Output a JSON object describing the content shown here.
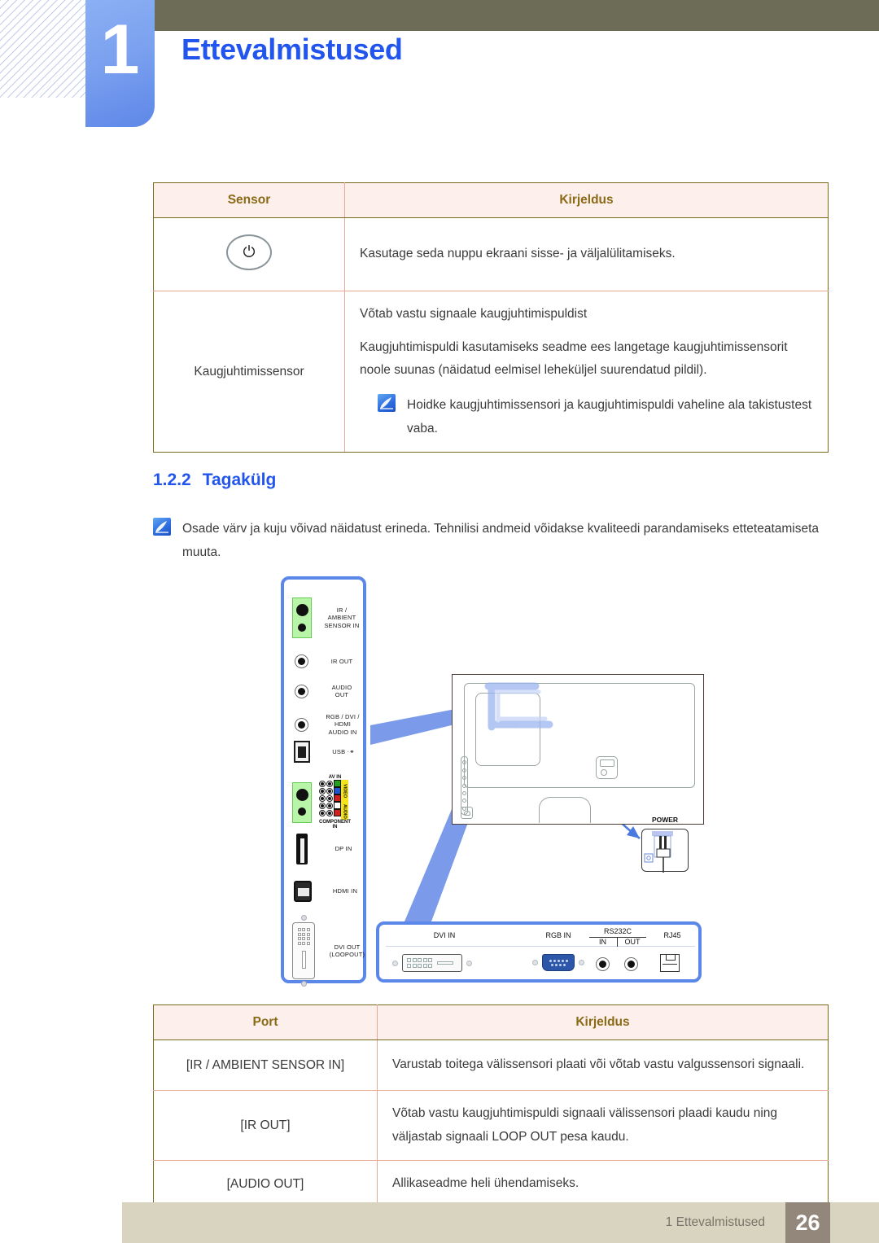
{
  "header": {
    "chapter_number": "1",
    "chapter_title": "Ettevalmistused"
  },
  "sensor_table": {
    "columns": [
      "Sensor",
      "Kirjeldus"
    ],
    "rows": [
      {
        "label": "",
        "label_icon": "power-icon",
        "paragraphs": [
          "Kasutage seda nuppu ekraani sisse- ja väljalülitamiseks."
        ],
        "note": null
      },
      {
        "label": "Kaugjuhtimissensor",
        "label_icon": null,
        "paragraphs": [
          "Võtab vastu signaale kaugjuhtimispuldist",
          "Kaugjuhtimispuldi kasutamiseks seadme ees langetage kaugjuhtimissensorit noole suunas (näidatud eelmisel leheküljel suurendatud pildil)."
        ],
        "note": "Hoidke kaugjuhtimissensori ja kaugjuhtimispuldi vaheline ala takistustest vaba."
      }
    ]
  },
  "section": {
    "number": "1.2.2",
    "title": "Tagakülg",
    "note": "Osade värv ja kuju võivad näidatust erineda. Tehnilisi andmeid võidakse kvaliteedi parandamiseks etteteatamiseta muuta."
  },
  "diagram": {
    "left_panel_ports": [
      "IR /\nAMBIENT\nSENSOR IN",
      "IR OUT",
      "AUDIO\nOUT",
      "RGB / DVI /\nHDMI\nAUDIO IN",
      "USB",
      "AV IN",
      "COMPONENT\nIN",
      "DP IN",
      "HDMI IN",
      "DVI OUT\n(LOOPOUT)"
    ],
    "av_in_caption_top": "AV IN",
    "av_in_caption_bottom": "COMPONENT\nIN",
    "av_in_tag_video": "VIDEO",
    "av_in_tag_audio": "AUDIO",
    "usb_label": "USB",
    "power_callout_label": "POWER",
    "bottom_panel_ports": [
      "DVI IN",
      "RGB IN",
      "RS232C",
      "IN",
      "OUT",
      "RJ45"
    ]
  },
  "port_table": {
    "columns": [
      "Port",
      "Kirjeldus"
    ],
    "rows": [
      {
        "port": "[IR / AMBIENT SENSOR IN]",
        "description": "Varustab toitega välissensori plaati või võtab vastu valgussensori signaali."
      },
      {
        "port": "[IR OUT]",
        "description": "Võtab vastu kaugjuhtimispuldi signaali välissensori plaadi kaudu ning väljastab signaali LOOP OUT pesa kaudu."
      },
      {
        "port": "[AUDIO OUT]",
        "description": "Allikaseadme heli ühendamiseks."
      }
    ]
  },
  "footer": {
    "text": "1 Ettevalmistused",
    "page_number": "26"
  },
  "colors": {
    "accent_blue": "#2255ee",
    "tab_blue": "#7ba1ef",
    "olive": "#6d6c57",
    "table_header_bg": "#fcefec",
    "table_header_text": "#8a6a16",
    "table_border": "#7a6a1e",
    "footer_bg": "#d9d4c0",
    "page_badge_bg": "#93877c",
    "diagram_blue": "#5b87e8",
    "highlight_arrow": "#7b9bea"
  }
}
